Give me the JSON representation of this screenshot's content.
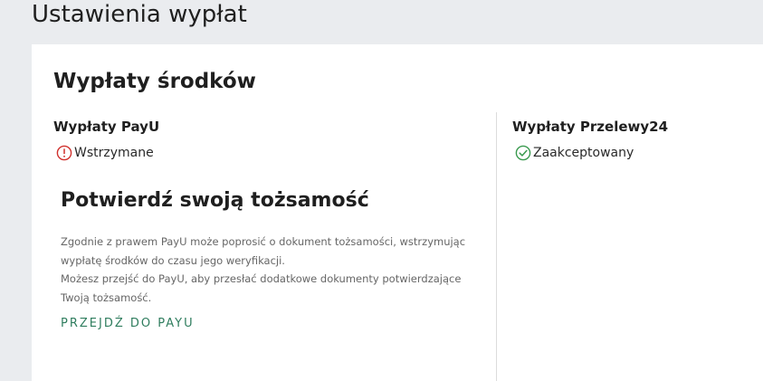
{
  "page": {
    "title": "Ustawienia wypłat"
  },
  "card": {
    "title": "Wypłaty środków",
    "payu": {
      "title": "Wypłaty PayU",
      "status_label": "Wstrzymane",
      "status_icon": "alert-circle-icon",
      "status_color": "#d0312d"
    },
    "przelewy24": {
      "title": "Wypłaty Przelewy24",
      "status_label": "Zaakceptowany",
      "status_icon": "check-circle-icon",
      "status_color": "#3a9a4f"
    },
    "verification": {
      "title": "Potwierdź swoją tożsamość",
      "lines": [
        "Zgodnie z prawem PayU może poprosić o dokument tożsamości, wstrzymując",
        "wypłatę środków do czasu jego weryfikacji.",
        "Możesz przejść do PayU, aby przesłać dodatkowe dokumenty potwierdzające",
        "Twoją tożsamość."
      ],
      "link_label": "PRZEJDŹ DO PAYU",
      "link_color": "#2f7d5e"
    }
  }
}
